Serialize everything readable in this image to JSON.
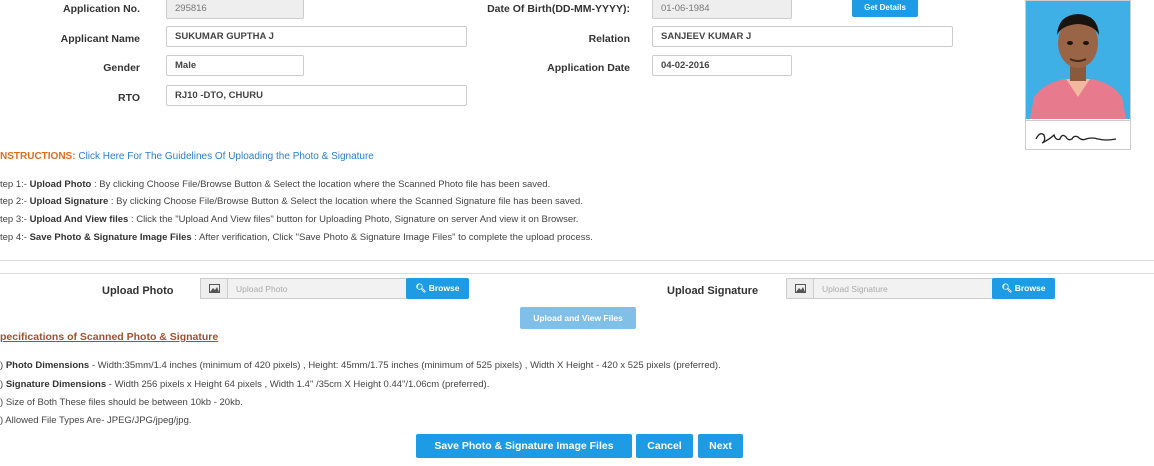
{
  "form": {
    "application_no": {
      "label": "Application No.",
      "value": "295816"
    },
    "dob": {
      "label": "Date Of Birth(DD-MM-YYYY):",
      "value": "01-06-1984"
    },
    "get_details": "Get Details",
    "applicant_name": {
      "label": "Applicant Name",
      "value": "SUKUMAR GUPTHA J"
    },
    "relation": {
      "label": "Relation",
      "value": "SANJEEV KUMAR J"
    },
    "gender": {
      "label": "Gender",
      "value": "Male"
    },
    "application_date": {
      "label": "Application Date",
      "value": "04-02-2016"
    },
    "rto": {
      "label": "RTO",
      "value": "RJ10 -DTO, CHURU"
    }
  },
  "instructions": {
    "title": "NSTRUCTIONS:",
    "link": "Click Here For The Guidelines Of Uploading the Photo & Signature",
    "steps": [
      {
        "prefix": "tep 1:- ",
        "bold": "Upload Photo",
        "text": " : By clicking Choose File/Browse Button & Select the location where the Scanned Photo file has been saved."
      },
      {
        "prefix": "tep 2:- ",
        "bold": "Upload Signature",
        "text": " : By clicking Choose File/Browse Button & Select the location where the Scanned Signature file has been saved."
      },
      {
        "prefix": "tep 3:- ",
        "bold": "Upload And View files",
        "text": " : Click the \"Upload And View files\" button for Uploading Photo, Signature on server And view it on Browser."
      },
      {
        "prefix": "tep 4:- ",
        "bold": "Save Photo & Signature Image Files",
        "text": " : After verification, Click \"Save Photo & Signature Image Files\" to complete the upload process."
      }
    ]
  },
  "upload": {
    "photo_label": "Upload Photo",
    "photo_placeholder": "Upload Photo",
    "signature_label": "Upload Signature",
    "signature_placeholder": "Upload Signature",
    "browse": "Browse",
    "upload_view": "Upload and View Files"
  },
  "specs": {
    "title": "pecifications of Scanned Photo & Signature",
    "items": [
      {
        "prefix": ") ",
        "bold": "Photo Dimensions",
        "text": " - Width:35mm/1.4 inches (minimum of 420 pixels) , Height: 45mm/1.75 inches (minimum of 525 pixels) , Width X Height - 420 x 525 pixels (preferred)."
      },
      {
        "prefix": ") ",
        "bold": "Signature Dimensions",
        "text": " - Width 256 pixels x Height 64 pixels , Width 1.4\" /35cm X Height 0.44\"/1.06cm (preferred)."
      },
      {
        "prefix": ") ",
        "bold": "",
        "text": "Size of Both These files should be between 10kb - 20kb."
      },
      {
        "prefix": ") ",
        "bold": "",
        "text": "Allowed File Types Are- JPEG/JPG/jpeg/jpg."
      }
    ]
  },
  "actions": {
    "save": "Save Photo & Signature Image Files",
    "cancel": "Cancel",
    "next": "Next"
  },
  "colors": {
    "accent": "#1d9ce5",
    "instructions_label": "#e06d1c",
    "link": "#2a7fd0",
    "spec_title": "#a0522d"
  }
}
